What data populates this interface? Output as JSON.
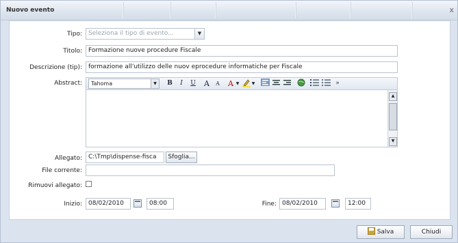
{
  "dialog": {
    "title": "Nuovo evento",
    "close_glyph": "x"
  },
  "form": {
    "tipo": {
      "label": "Tipo:",
      "placeholder": "Seleziona il tipo di evento..."
    },
    "titolo": {
      "label": "Titolo:",
      "value": "Formazione nuove procedure Fiscale"
    },
    "descrizione": {
      "label": "Descrizione (tip):",
      "value": "formazione all'utilizzo delle nuov eprocedure informatiche per Fiscale"
    },
    "abstract": {
      "label": "Abstract:",
      "font": "Tahoma"
    },
    "allegato": {
      "label": "Allegato:",
      "value": "C:\\Tmp\\dispense-fisca",
      "browse_label": "Sfoglia..."
    },
    "file_corrente": {
      "label": "File corrente:",
      "value": ""
    },
    "rimuovi": {
      "label": "Rimuovi allegato:"
    },
    "inizio": {
      "label": "Inizio:",
      "date": "08/02/2010",
      "time": "08:00"
    },
    "fine": {
      "label": "Fine:",
      "date": "08/02/2010",
      "time": "12:00"
    }
  },
  "toolbar": {
    "bold": "B",
    "italic": "I",
    "underline": "U",
    "grow": "A",
    "shrink": "A",
    "font_color": "A",
    "more": "»"
  },
  "buttons": {
    "save": "Salva",
    "close": "Chiudi"
  }
}
